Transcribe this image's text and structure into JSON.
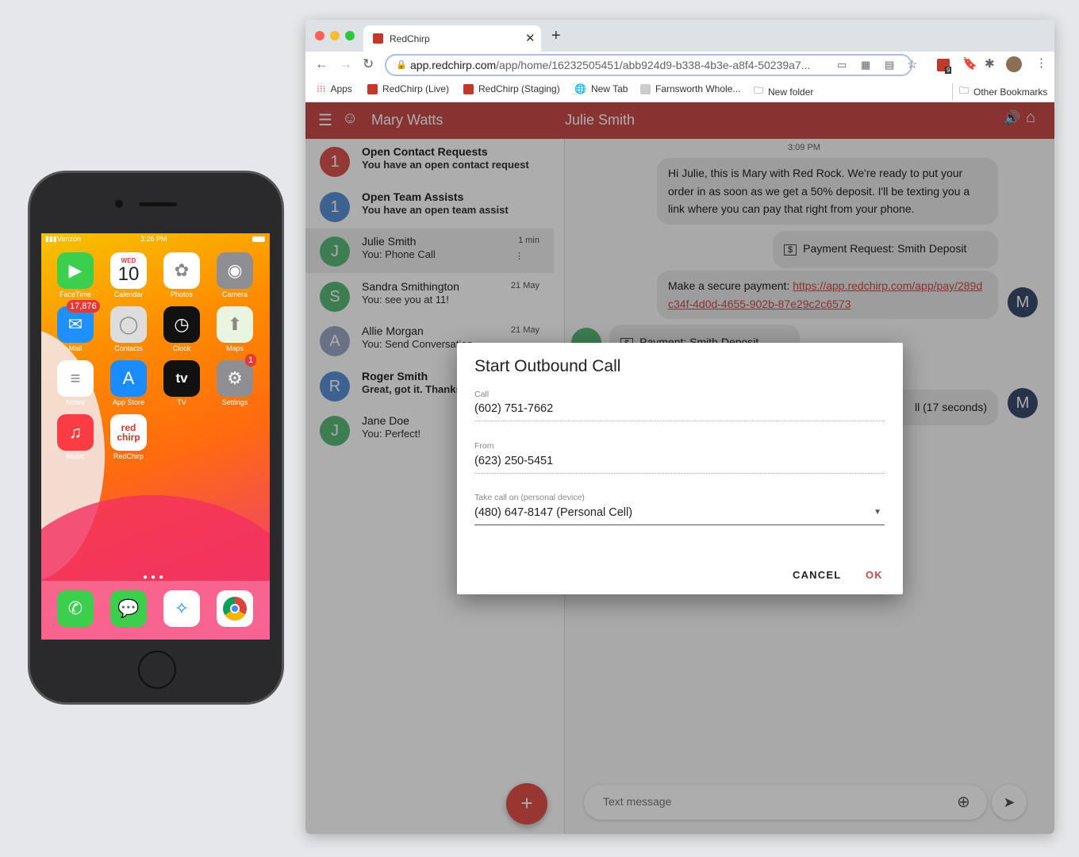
{
  "phone": {
    "carrier": "Verizon",
    "time": "3:26 PM",
    "calendar_day": "WED",
    "calendar_date": "10",
    "apps": [
      {
        "label": "FaceTime"
      },
      {
        "label": "Calendar"
      },
      {
        "label": "Photos"
      },
      {
        "label": "Camera"
      },
      {
        "label": "Mail",
        "badge": "17,876"
      },
      {
        "label": "Contacts"
      },
      {
        "label": "Clock"
      },
      {
        "label": "Maps"
      },
      {
        "label": "Notes"
      },
      {
        "label": "App Store"
      },
      {
        "label": "TV"
      },
      {
        "label": "Settings",
        "badge": "1"
      },
      {
        "label": "Music"
      },
      {
        "label": "RedChirp"
      }
    ],
    "redchirp_logo": "red chirp",
    "tv_logo": "tv",
    "dock": [
      "phone",
      "messages",
      "safari",
      "chrome"
    ]
  },
  "browser": {
    "tab_title": "RedChirp",
    "url_host": "app.redchirp.com",
    "url_path": "/app/home/16232505451/abb924d9-b338-4b3e-a8f4-50239a7...",
    "ext_badge": "9",
    "bookmarks": [
      "Apps",
      "RedChirp (Live)",
      "RedChirp (Staging)",
      "New Tab",
      "Farnsworth Whole...",
      "New folder"
    ],
    "other_bookmarks": "Other Bookmarks"
  },
  "app": {
    "user": "Mary Watts",
    "contact": "Julie Smith",
    "accent": "#c94a4a",
    "list": [
      {
        "avatar": "1",
        "title": "Open Contact Requests",
        "sub": "You have an open contact request",
        "bold": true,
        "color": "#d9534f"
      },
      {
        "avatar": "1",
        "title": "Open Team Assists",
        "sub": "You have an open team assist",
        "bold": true,
        "color": "#5b8fd6"
      },
      {
        "avatar": "J",
        "title": "Julie Smith",
        "sub": "You: Phone Call",
        "date": "1 min",
        "color": "#5cb87a"
      },
      {
        "avatar": "S",
        "title": "Sandra Smithington",
        "sub": "You: see you at 11!",
        "date": "21 May",
        "color": "#5cb87a"
      },
      {
        "avatar": "A",
        "title": "Allie Morgan",
        "sub": "You: Send Conversation",
        "date": "21 May",
        "color": "#9ea7c4"
      },
      {
        "avatar": "R",
        "title": "Roger Smith",
        "sub": "Great, got it. Thanks",
        "bold": true,
        "color": "#5b8fd6"
      },
      {
        "avatar": "J",
        "title": "Jane Doe",
        "sub": "You: Perfect!",
        "color": "#5cb87a"
      }
    ],
    "chat": {
      "time": "3:09 PM",
      "msg1": "Hi Julie, this is Mary with Red Rock. We're ready to put your order in as soon as we get a 50% deposit. I'll be texting you a link where you can pay that right from your phone.",
      "payment_request": "Payment Request: Smith Deposit",
      "payment_prefix": "Make a secure payment: ",
      "payment_link": "https://app.redchirp.com/app/pay/289dc34f-4d0d-4655-902b-87e29c2c6573",
      "payment_partial": "Payment: Smith Deposit",
      "call_partial": "ll (17 seconds)",
      "me_avatar": "M",
      "input_placeholder": "Text message"
    },
    "fab": "+"
  },
  "dialog": {
    "title": "Start Outbound Call",
    "call_label": "Call",
    "call_value": "(602) 751-7662",
    "from_label": "From",
    "from_value": "(623) 250-5451",
    "device_label": "Take call on (personal device)",
    "device_value": "(480) 647-8147 (Personal Cell)",
    "cancel": "CANCEL",
    "ok": "OK"
  }
}
